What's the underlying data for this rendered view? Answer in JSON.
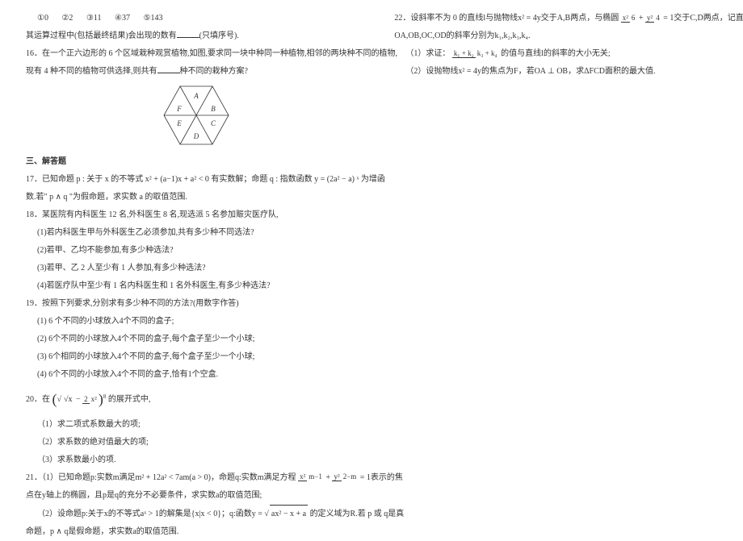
{
  "left": {
    "opts": [
      "①0",
      "②2",
      "③11",
      "④37",
      "⑤143"
    ],
    "opts_line2": "其运算过程中(包括最终结果)会出现的数有",
    "opts_line2_tail": "(只填序号).",
    "q16a": "16．在一个正六边形的 6 个区域栽种观赏植物,如图,要求同一块中种同一种植物,相邻的两块种不同的植物,",
    "q16b": "现有 4 种不同的植物可供选择,则共有",
    "q16b_tail": "种不同的栽种方案?",
    "hex_labels": [
      "A",
      "B",
      "C",
      "D",
      "E",
      "F"
    ],
    "section3": "三、解答题",
    "q17a": "17．已知命题 p : 关于 x 的不等式 x² + (a−1)x + a² < 0 有实数解；命题 q : 指数函数 y = (2a² − a) ˣ 为增函",
    "q17b": "数.若\" p ∧ q \"为假命题，求实数 a 的取值范围.",
    "q18": "18．某医院有内科医生 12 名,外科医生 8 名,现选派 5 名参加赈灾医疗队,",
    "q18_1": "(1)若内科医生甲与外科医生乙必须参加,共有多少种不同选法?",
    "q18_2": "(2)若甲、乙均不能参加,有多少种选法?",
    "q18_3": "(3)若甲、乙 2 人至少有 1 人参加,有多少种选法?",
    "q18_4": "(4)若医疗队中至少有 1 名内科医生和 1 名外科医生,有多少种选法?",
    "q19": "19．按照下列要求,分别求有多少种不同的方法?(用数字作答)",
    "q19_1": "(1) 6 个不同的小球放入4个不同的盒子;",
    "q19_2": "(2) 6个不同的小球放入4个不同的盒子,每个盒子至少一个小球;",
    "q19_3": "(3) 6个相同的小球放入4个不同的盒子,每个盒子至少一个小球;",
    "q19_4": "(4) 6个不同的小球放入4个不同的盒子,恰有1个空盒.",
    "q20_pre": "20．在",
    "q20_inner_a": "√x",
    "q20_inner_b": "2",
    "q20_inner_c": "x²",
    "q20_exp": "8",
    "q20_post": "的展开式中,",
    "q20_1": "（1）求二项式系数最大的项;",
    "q20_2": "（2）求系数的绝对值最大的项;",
    "q20_3": "（3）求系数最小的项.",
    "q21_1a": "21．（1）已知命题p:实数m满足m² + 12a² < 7am(a > 0)，命题q:实数m满足方程",
    "q21_1_frac1n": "x²",
    "q21_1_frac1d": "m−1",
    "q21_1_frac2n": "y²",
    "q21_1_frac2d": "2−m",
    "q21_1b": "= 1表示的焦",
    "q21_1c": "点在y轴上的椭圆，且p是q的充分不必要条件，求实数a的取值范围;",
    "q21_2a": "（2）设命题p:关于x的不等式aˣ > 1的解集是{x|x < 0}；q:函数y =",
    "q21_2_sqrt": "ax² − x + a",
    "q21_2b": "的定义域为R.若 p 或 q是真",
    "q21_2c": "命题，p ∧ q是假命题，求实数a的取值范围."
  },
  "right": {
    "q22a": "22．设斜率不为 0 的直线l与抛物线x² = 4y交于A,B两点，与椭圆",
    "q22_frac1n": "x²",
    "q22_frac1d": "6",
    "q22_frac2n": "y²",
    "q22_frac2d": "4",
    "q22b": "= 1交于C,D两点，记直线",
    "q22c": "OA,OB,OC,OD的斜率分别为k₁,k₂,k₃,k₄.",
    "q22_1a": "（1）求证：",
    "q22_1_fracn": "k₁ + k₂",
    "q22_1_fracd": "k₃ + k₄",
    "q22_1b": "的值与直线l的斜率的大小无关;",
    "q22_2": "（2）设抛物线x² = 4y的焦点为F，若OA ⊥ OB，求ΔFCD面积的最大值."
  }
}
